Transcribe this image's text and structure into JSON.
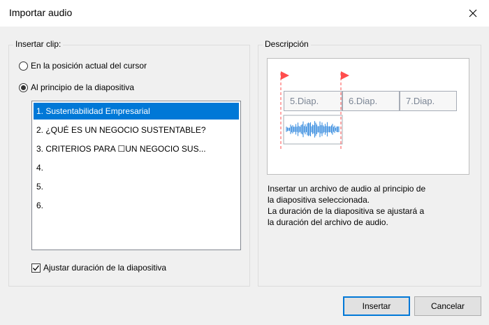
{
  "window": {
    "title": "Importar audio"
  },
  "insert_group": {
    "legend": "Insertar clip:",
    "radio_options": [
      {
        "label": "En la posición actual del cursor",
        "checked": false
      },
      {
        "label": "Al principio de la diapositiva",
        "checked": true
      }
    ],
    "slides": [
      {
        "label": "1. Sustentabilidad Empresarial",
        "selected": true
      },
      {
        "label": "2. ¿QUÉ ES UN NEGOCIO SUSTENTABLE?",
        "selected": false
      },
      {
        "label": "3. CRITERIOS PARA ☐UN NEGOCIO SUS...",
        "selected": false
      },
      {
        "label": "4.",
        "selected": false
      },
      {
        "label": "5.",
        "selected": false
      },
      {
        "label": "6.",
        "selected": false
      }
    ],
    "checkbox": {
      "label": "Ajustar duración de la diapositiva",
      "checked": true
    }
  },
  "description_group": {
    "legend": "Descripción",
    "preview": {
      "slide_labels": [
        "5.Diap.",
        "6.Diap.",
        "7.Diap."
      ],
      "marker_color": "#ff4d4d",
      "waveform_color": "#3d8fe0"
    },
    "text_lines": [
      "Insertar un archivo de audio al principio de",
      "la diapositiva seleccionada.",
      "La duración de la diapositiva se ajustará a",
      "la duración del archivo de audio."
    ]
  },
  "buttons": {
    "insert": "Insertar",
    "cancel": "Cancelar"
  }
}
